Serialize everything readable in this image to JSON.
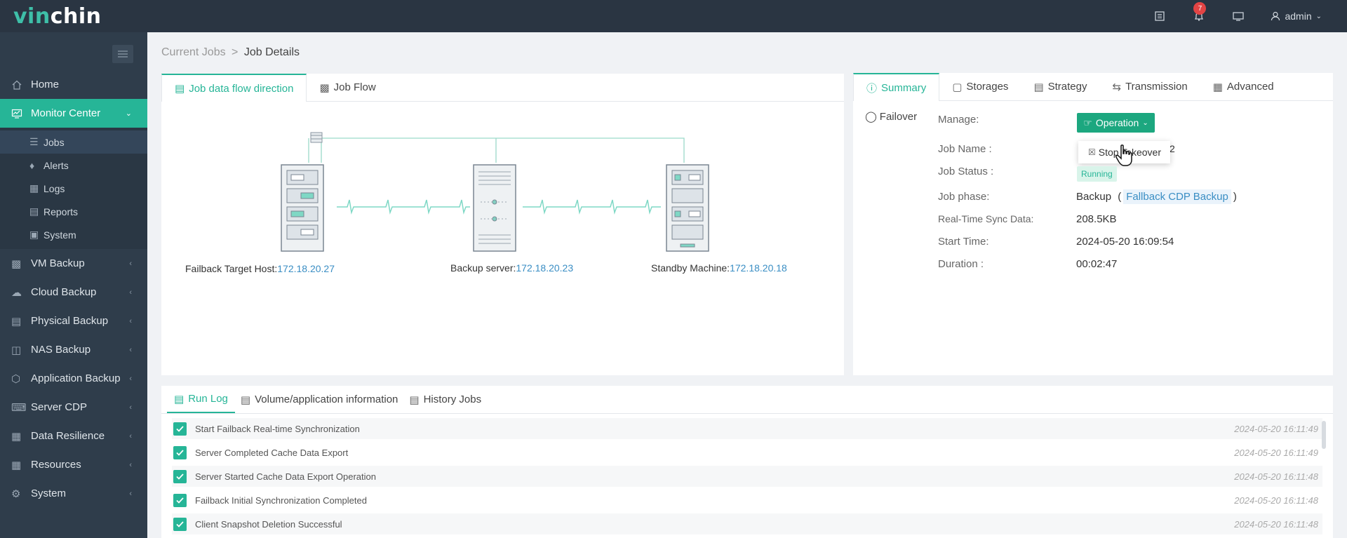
{
  "brand": {
    "logo_vin": "vin",
    "logo_chin": "chin"
  },
  "topbar": {
    "notification_count": "7",
    "user": "admin"
  },
  "sidebar": {
    "items": [
      {
        "label": "Home",
        "icon": "home-icon"
      },
      {
        "label": "Monitor Center",
        "icon": "monitor-icon",
        "active": true
      },
      {
        "label": "VM Backup",
        "icon": "vm-icon"
      },
      {
        "label": "Cloud Backup",
        "icon": "cloud-icon"
      },
      {
        "label": "Physical Backup",
        "icon": "physical-icon"
      },
      {
        "label": "NAS Backup",
        "icon": "nas-icon"
      },
      {
        "label": "Application Backup",
        "icon": "application-icon"
      },
      {
        "label": "Server CDP",
        "icon": "cdp-icon"
      },
      {
        "label": "Data Resilience",
        "icon": "resilience-icon"
      },
      {
        "label": "Resources",
        "icon": "resources-icon"
      },
      {
        "label": "System",
        "icon": "gear-icon"
      }
    ],
    "submenu": [
      {
        "label": "Jobs",
        "active": true
      },
      {
        "label": "Alerts"
      },
      {
        "label": "Logs"
      },
      {
        "label": "Reports"
      },
      {
        "label": "System"
      }
    ]
  },
  "breadcrumb": {
    "parent": "Current Jobs",
    "sep": ">",
    "current": "Job Details"
  },
  "left_panel": {
    "tabs": [
      "Job data flow direction",
      "Job Flow"
    ],
    "nodes": [
      {
        "label": "Failback Target Host:",
        "ip": "172.18.20.27"
      },
      {
        "label": "Backup server:",
        "ip": "172.18.20.23"
      },
      {
        "label": "Standby Machine:",
        "ip": "172.18.20.18"
      }
    ]
  },
  "right_panel": {
    "tabs": [
      "Summary",
      "Storages",
      "Strategy",
      "Transmission",
      "Advanced"
    ],
    "type_label": "Failover",
    "manage_label": "Manage:",
    "operation_button": "Operation",
    "dropdown_item": "Stop Takeover",
    "job_name_key": "Job Name :",
    "job_name_tail": "2",
    "job_status_key": "Job Status :",
    "job_status_val": "Running",
    "phase_key": "Job phase:",
    "phase_val": "Backup",
    "phase_paren_open": "(",
    "phase_link": "Fallback CDP Backup",
    "phase_paren_close": ")",
    "sync_key": "Real-Time Sync Data:",
    "sync_val": "208.5KB",
    "start_key": "Start Time:",
    "start_val": "2024-05-20 16:09:54",
    "duration_key": "Duration :",
    "duration_val": "00:02:47"
  },
  "bottom_panel": {
    "tabs": [
      "Run Log",
      "Volume/application information",
      "History Jobs"
    ],
    "logs": [
      {
        "text": "Start Failback Real-time Synchronization",
        "time": "2024-05-20 16:11:49"
      },
      {
        "text": "Server Completed Cache Data Export",
        "time": "2024-05-20 16:11:49"
      },
      {
        "text": "Server Started Cache Data Export Operation",
        "time": "2024-05-20 16:11:48"
      },
      {
        "text": "Failback Initial Synchronization Completed",
        "time": "2024-05-20 16:11:48"
      },
      {
        "text": "Client Snapshot Deletion Successful",
        "time": "2024-05-20 16:11:48"
      }
    ]
  },
  "colors": {
    "accent": "#26b597",
    "topbar": "#2a3542",
    "sidebar": "#2f3d4b",
    "link": "#3a8ec4"
  }
}
